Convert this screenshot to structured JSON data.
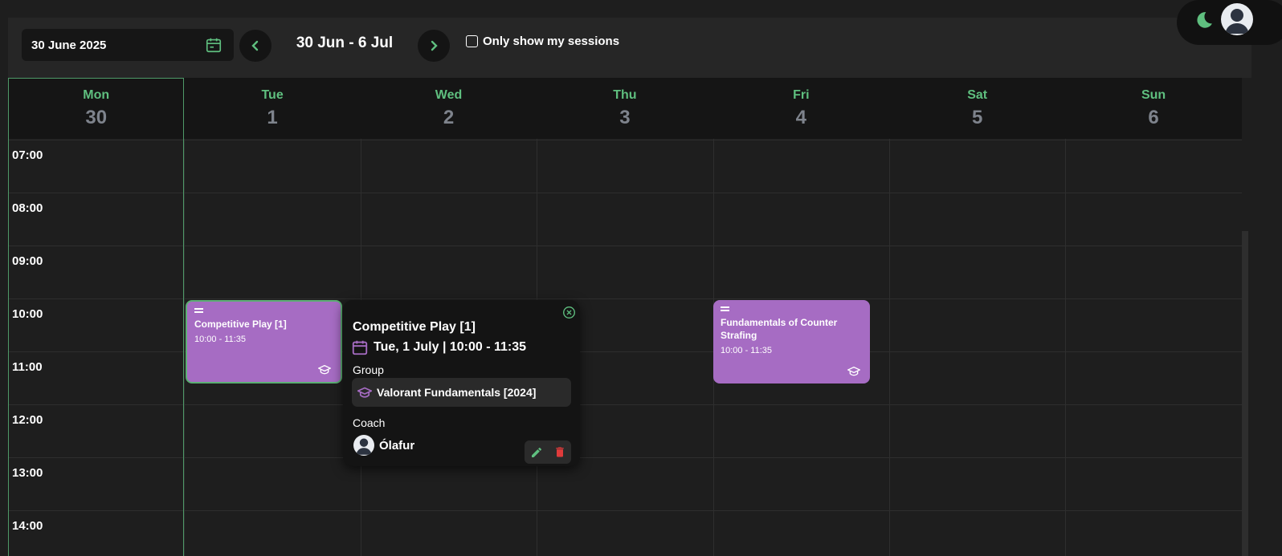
{
  "toolbar": {
    "date_value": "30 June 2025",
    "week_range": "30 Jun - 6 Jul",
    "only_mine_label": "Only show my sessions",
    "only_mine_checked": false
  },
  "days": [
    {
      "name": "Mon",
      "num": "30"
    },
    {
      "name": "Tue",
      "num": "1"
    },
    {
      "name": "Wed",
      "num": "2"
    },
    {
      "name": "Thu",
      "num": "3"
    },
    {
      "name": "Fri",
      "num": "4"
    },
    {
      "name": "Sat",
      "num": "5"
    },
    {
      "name": "Sun",
      "num": "6"
    }
  ],
  "times": [
    "07:00",
    "08:00",
    "09:00",
    "10:00",
    "11:00",
    "12:00",
    "13:00",
    "14:00"
  ],
  "events": [
    {
      "title": "Competitive Play [1]",
      "time": "10:00 - 11:35"
    },
    {
      "title": "Fundamentals of Counter Strafing",
      "time": "10:00 - 11:35"
    }
  ],
  "popover": {
    "title": "Competitive Play [1]",
    "date_line": "Tue, 1 July | 10:00 - 11:35",
    "group_label": "Group",
    "group_name": "Valorant Fundamentals [2024]",
    "coach_label": "Coach",
    "coach_name": "Ólafur"
  },
  "colors": {
    "accent_green": "#5fbf7f",
    "event_purple": "#a66cc3",
    "delete_red": "#e03b3b",
    "background": "#1e1e1e"
  },
  "icons": [
    "calendar-icon",
    "chevron-left-icon",
    "chevron-right-icon",
    "moon-icon",
    "avatar",
    "graduation-cap-icon",
    "close-circle-icon",
    "pencil-icon",
    "trash-icon",
    "drag-handle-icon"
  ]
}
